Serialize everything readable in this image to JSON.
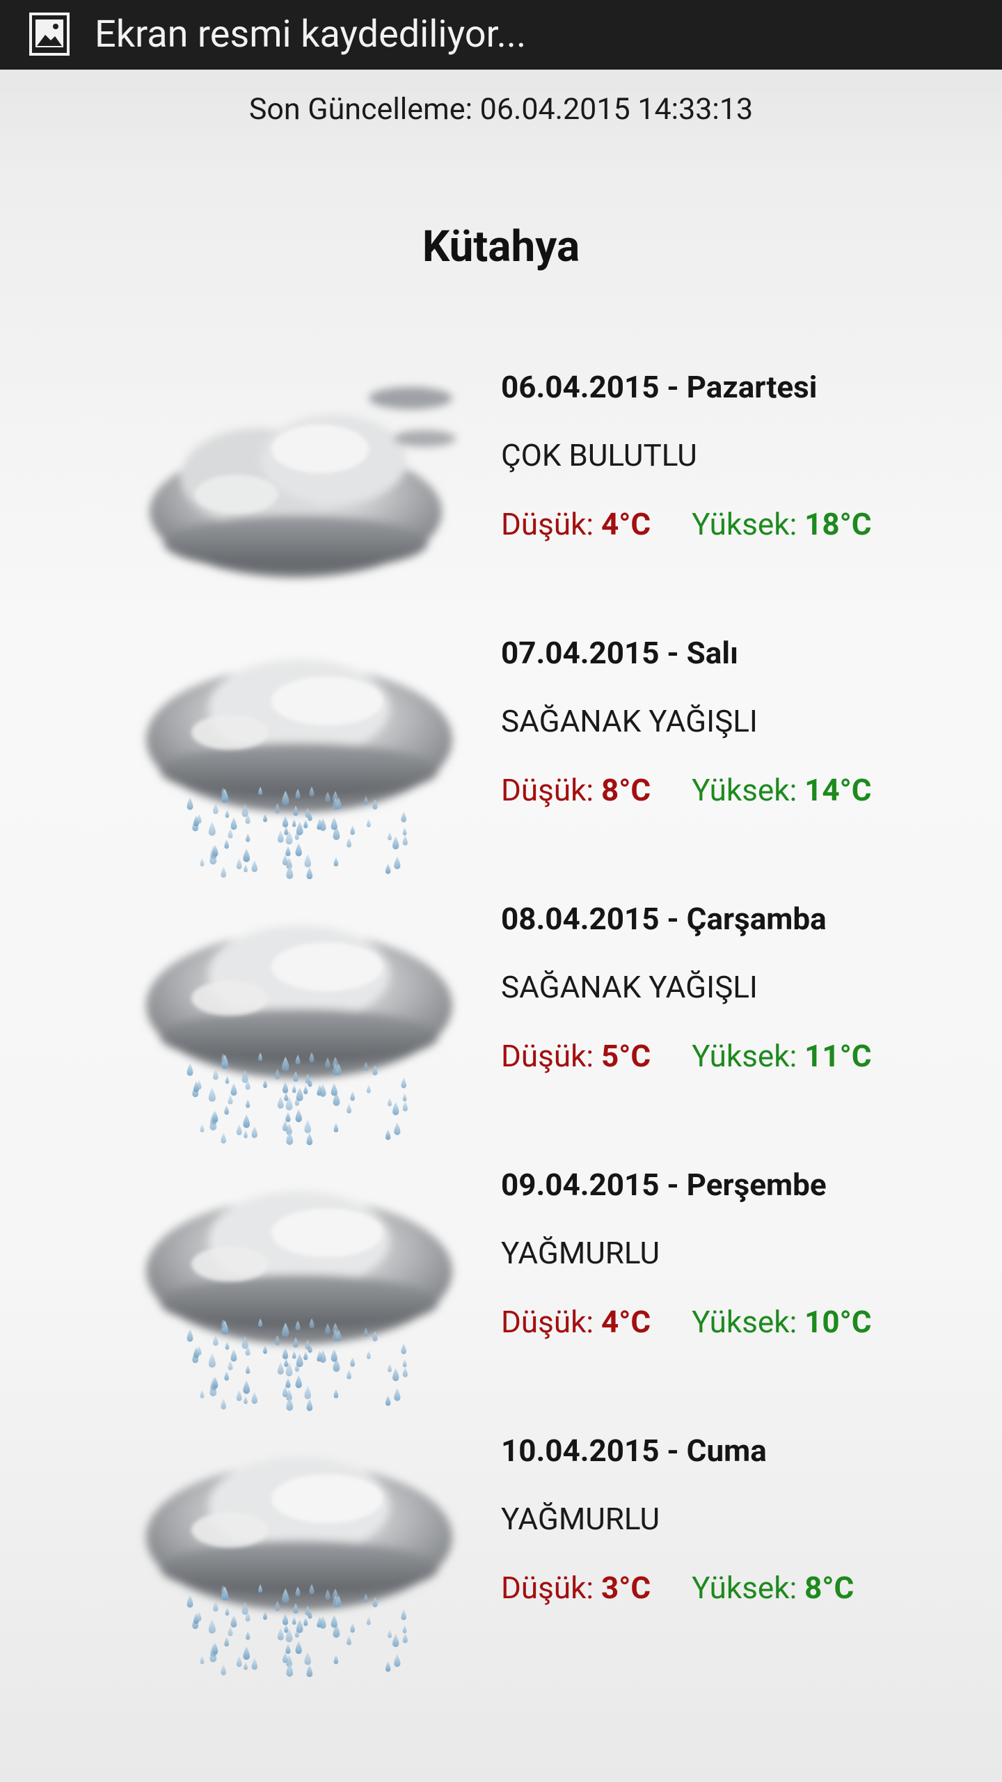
{
  "status_bar": {
    "text": "Ekran resmi kaydediliyor...",
    "icon": "gallery-image-icon"
  },
  "last_update": "Son Güncelleme: 06.04.2015 14:33:13",
  "city": "Kütahya",
  "labels": {
    "low": "Düşük:",
    "high": "Yüksek:"
  },
  "colors": {
    "low": "#a30f0f",
    "high": "#1d8a1d"
  },
  "days": [
    {
      "date": "06.04.2015 - Pazartesi",
      "condition": "ÇOK BULUTLU",
      "low": "4°C",
      "high": "18°C",
      "icon": "cloudy-icon"
    },
    {
      "date": "07.04.2015 - Salı",
      "condition": "SAĞANAK YAĞIŞLI",
      "low": "8°C",
      "high": "14°C",
      "icon": "rain-cloud-icon"
    },
    {
      "date": "08.04.2015 - Çarşamba",
      "condition": "SAĞANAK YAĞIŞLI",
      "low": "5°C",
      "high": "11°C",
      "icon": "rain-cloud-icon"
    },
    {
      "date": "09.04.2015 - Perşembe",
      "condition": "YAĞMURLU",
      "low": "4°C",
      "high": "10°C",
      "icon": "rain-cloud-icon"
    },
    {
      "date": "10.04.2015 - Cuma",
      "condition": "YAĞMURLU",
      "low": "3°C",
      "high": "8°C",
      "icon": "rain-cloud-icon"
    }
  ]
}
